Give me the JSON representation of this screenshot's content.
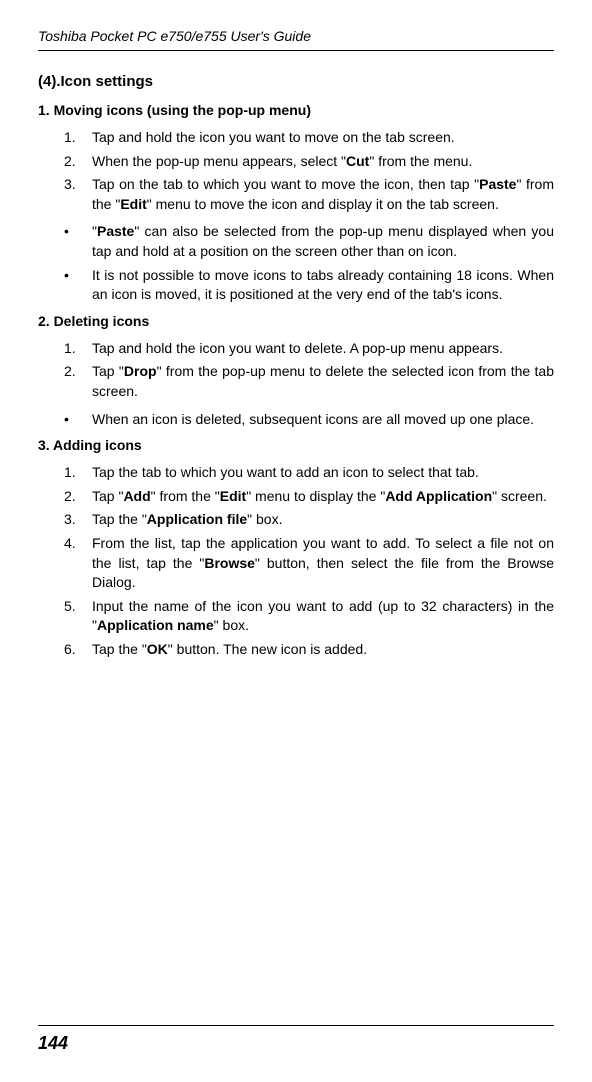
{
  "header": {
    "title": "Toshiba Pocket PC e750/e755  User's Guide"
  },
  "section": {
    "heading": "(4).Icon settings",
    "sub1": {
      "heading": "1.    Moving icons (using the pop-up menu)",
      "items": [
        {
          "m": "1.",
          "t": "Tap and hold the icon you want to move on the tab screen."
        },
        {
          "m": "2.",
          "t": "When the pop-up menu appears, select \"<b>Cut</b>\" from the menu."
        },
        {
          "m": "3.",
          "t": "Tap on the tab to which you want to move the icon, then tap \"<b>Paste</b>\" from the \"<b>Edit</b>\" menu to move the icon and display it on the tab screen."
        }
      ],
      "bullets": [
        {
          "m": "•",
          "t": "\"<b>Paste</b>\" can also be selected from the pop-up menu displayed when you tap and hold at a position on the screen other than on icon."
        },
        {
          "m": "•",
          "t": "It is not possible to move icons to tabs already containing 18 icons. When an icon is moved, it is positioned at the very end of the tab's icons."
        }
      ]
    },
    "sub2": {
      "heading": "2.    Deleting icons",
      "items": [
        {
          "m": "1.",
          "t": "Tap and hold the icon you want to delete. A pop-up menu appears."
        },
        {
          "m": "2.",
          "t": "Tap \"<b>Drop</b>\" from the pop-up menu to delete the selected icon from the tab screen."
        }
      ],
      "bullets": [
        {
          "m": "•",
          "t": "When an icon is deleted, subsequent icons are all moved up one place."
        }
      ]
    },
    "sub3": {
      "heading": "3.    Adding icons",
      "items": [
        {
          "m": "1.",
          "t": "Tap the tab to which you want to add an icon to select that tab."
        },
        {
          "m": "2.",
          "t": "Tap \"<b>Add</b>\" from the \"<b>Edit</b>\" menu to display the \"<b>Add Application</b>\" screen."
        },
        {
          "m": "3.",
          "t": "Tap the \"<b>Application file</b>\" box."
        },
        {
          "m": "4.",
          "t": "From the list, tap the application you want to add. To select a file not on the list, tap the \"<b>Browse</b>\" button, then select the file from the Browse Dialog."
        },
        {
          "m": "5.",
          "t": "Input the name of the icon you want to add (up to 32 characters) in the \"<b>Application name</b>\" box."
        },
        {
          "m": "6.",
          "t": "Tap the \"<b>OK</b>\" button. The new icon is added."
        }
      ]
    }
  },
  "page": "144"
}
